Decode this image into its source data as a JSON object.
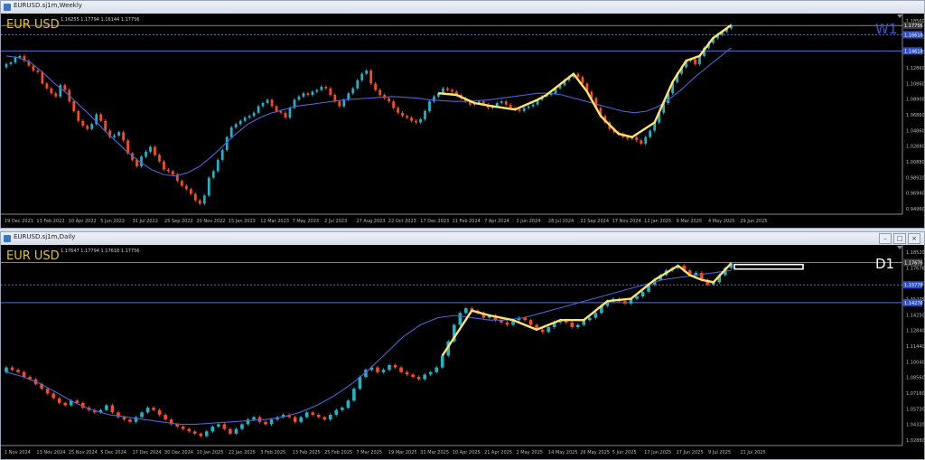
{
  "charts": [
    {
      "window_title": "EURUSD.sj1m,Weekly",
      "symbol_label": "EUR USD",
      "timeframe_label": "W1",
      "ohlc_readout": "1.16255 1.17794 1.16144 1.17756",
      "window_buttons": [],
      "colors": {
        "bull": "#1fb5c9",
        "bear": "#ff4a1a",
        "ma": "#4c63d8",
        "zigzag": "#ffe36e",
        "hline": "#5a6fd8",
        "bg": "#000000",
        "axis": "#b9b9b9"
      },
      "price_labels": [
        "1.18560",
        "1.16650",
        "1.14640",
        "1.12860",
        "1.10860",
        "1.08900",
        "1.06860",
        "1.04860",
        "1.02880",
        "1.00880",
        "0.98920",
        "0.96940",
        "0.94960"
      ],
      "price_tags": [
        {
          "text": "1.17756",
          "value": 1.17756,
          "style": "current"
        },
        {
          "text": "1.16618",
          "value": 1.16618,
          "style": "level"
        },
        {
          "text": "1.14618",
          "value": 1.14618,
          "style": "level"
        }
      ],
      "date_labels": [
        "19 Dec 2021",
        "13 Feb 2022",
        "10 Apr 2022",
        "5 Jun 2022",
        "31 Jul 2022",
        "25 Sep 2022",
        "20 Nov 2022",
        "15 Jan 2023",
        "12 Mar 2023",
        "7 May 2023",
        "2 Jul 2023",
        "27 Aug 2023",
        "22 Oct 2023",
        "17 Dec 2023",
        "11 Feb 2024",
        "7 Apr 2024",
        "2 Jun 2024",
        "28 Jul 2024",
        "22 Sep 2024",
        "17 Nov 2024",
        "12 Jan 2025",
        "9 Mar 2025",
        "4 May 2025",
        "29 Jun 2025"
      ]
    },
    {
      "window_title": "EURUSD.sj1m,Daily",
      "symbol_label": "EUR USD",
      "timeframe_label": "D1",
      "ohlc_readout": "1.17647 1.17794 1.17618 1.17756",
      "window_buttons": [
        "–",
        "□",
        "×"
      ],
      "colors": {
        "bull": "#1fb5c9",
        "bear": "#ff4a1a",
        "ma": "#4c63d8",
        "zigzag": "#ffe36e",
        "hline": "#5a6fd8",
        "bg": "#000000",
        "axis": "#b9b9b9"
      },
      "price_labels": [
        "1.18520",
        "1.17676",
        "1.16240",
        "1.15275",
        "1.14250",
        "1.12840",
        "1.11440",
        "1.10040",
        "1.08560",
        "1.07160",
        "1.05720",
        "1.04320",
        "1.02880"
      ],
      "price_tags": [
        {
          "text": "1.17676",
          "value": 1.17676,
          "style": "current"
        },
        {
          "text": "1.15778",
          "value": 1.15778,
          "style": "level"
        },
        {
          "text": "1.14278",
          "value": 1.14278,
          "style": "level"
        }
      ],
      "date_labels": [
        "1 Nov 2024",
        "13 Nov 2024",
        "25 Nov 2024",
        "5 Dec 2024",
        "17 Dec 2024",
        "30 Dec 2024",
        "10 Jan 2025",
        "22 Jan 2025",
        "3 Feb 2025",
        "13 Feb 2025",
        "25 Feb 2025",
        "7 Mar 2025",
        "19 Mar 2025",
        "31 Mar 2025",
        "10 Apr 2025",
        "21 Apr 2025",
        "2 May 2025",
        "14 May 2025",
        "26 May 2025",
        "5 Jun 2025",
        "17 Jun 2025",
        "27 Jun 2025",
        "9 Jul 2025",
        "21 Jul 2025"
      ]
    }
  ],
  "chart_data": [
    {
      "type": "candlestick",
      "title": "EURUSD.sj1m,Weekly",
      "ylim": [
        0.945,
        1.19
      ],
      "x_range": [
        "19 Dec 2021",
        "29 Jun 2025"
      ],
      "series": [
        {
          "name": "price",
          "values": [
            1.13,
            1.132,
            1.138,
            1.14,
            1.134,
            1.128,
            1.122,
            1.12,
            1.106,
            1.1,
            1.094,
            1.09,
            1.104,
            1.098,
            1.084,
            1.072,
            1.06,
            1.054,
            1.05,
            1.056,
            1.068,
            1.06,
            1.048,
            1.04,
            1.042,
            1.046,
            1.036,
            1.02,
            1.012,
            1.004,
            1.016,
            1.022,
            1.028,
            1.018,
            1.01,
            1.0,
            0.998,
            0.994,
            0.986,
            0.98,
            0.976,
            0.97,
            0.962,
            0.958,
            0.968,
            0.99,
            0.998,
            1.012,
            1.024,
            1.04,
            1.052,
            1.056,
            1.06,
            1.064,
            1.066,
            1.07,
            1.078,
            1.082,
            1.086,
            1.078,
            1.072,
            1.07,
            1.064,
            1.076,
            1.086,
            1.09,
            1.094,
            1.092,
            1.096,
            1.098,
            1.102,
            1.1,
            1.092,
            1.084,
            1.078,
            1.086,
            1.094,
            1.1,
            1.11,
            1.118,
            1.122,
            1.106,
            1.098,
            1.092,
            1.088,
            1.084,
            1.076,
            1.07,
            1.066,
            1.064,
            1.06,
            1.058,
            1.062,
            1.072,
            1.084,
            1.09,
            1.094,
            1.1,
            1.098,
            1.096,
            1.092,
            1.088,
            1.084,
            1.08,
            1.082,
            1.084,
            1.08,
            1.076,
            1.078,
            1.082,
            1.084,
            1.08,
            1.076,
            1.074,
            1.072,
            1.076,
            1.078,
            1.08,
            1.086,
            1.09,
            1.092,
            1.094,
            1.1,
            1.104,
            1.11,
            1.114,
            1.118,
            1.114,
            1.106,
            1.096,
            1.088,
            1.076,
            1.066,
            1.058,
            1.05,
            1.046,
            1.044,
            1.04,
            1.038,
            1.04,
            1.036,
            1.032,
            1.04,
            1.048,
            1.058,
            1.07,
            1.082,
            1.094,
            1.108,
            1.118,
            1.126,
            1.134,
            1.136,
            1.13,
            1.14,
            1.15,
            1.156,
            1.162,
            1.166,
            1.17,
            1.174,
            1.178
          ]
        },
        {
          "name": "ma",
          "values": [
            1.14,
            1.138,
            1.132,
            1.12,
            1.106,
            1.094,
            1.08,
            1.066,
            1.05,
            1.036,
            1.022,
            1.01,
            1.0,
            0.994,
            0.992,
            0.996,
            1.004,
            1.016,
            1.03,
            1.044,
            1.056,
            1.064,
            1.07,
            1.074,
            1.078,
            1.08,
            1.082,
            1.084,
            1.086,
            1.087,
            1.088,
            1.089,
            1.09,
            1.089,
            1.088,
            1.086,
            1.085,
            1.084,
            1.084,
            1.085,
            1.086,
            1.088,
            1.09,
            1.092,
            1.094,
            1.094,
            1.092,
            1.088,
            1.084,
            1.08,
            1.076,
            1.072,
            1.07,
            1.072,
            1.078,
            1.088,
            1.1,
            1.114,
            1.126,
            1.138,
            1.15
          ]
        }
      ]
    },
    {
      "type": "candlestick",
      "title": "EURUSD.sj1m,Daily",
      "ylim": [
        1.022,
        1.19
      ],
      "x_range": [
        "1 Nov 2024",
        "21 Jul 2025"
      ],
      "series": [
        {
          "name": "price",
          "values": [
            1.088,
            1.086,
            1.084,
            1.08,
            1.078,
            1.074,
            1.07,
            1.066,
            1.062,
            1.058,
            1.056,
            1.06,
            1.058,
            1.054,
            1.052,
            1.05,
            1.052,
            1.056,
            1.05,
            1.046,
            1.044,
            1.042,
            1.046,
            1.05,
            1.054,
            1.052,
            1.048,
            1.044,
            1.04,
            1.038,
            1.036,
            1.034,
            1.032,
            1.03,
            1.034,
            1.038,
            1.04,
            1.036,
            1.032,
            1.036,
            1.04,
            1.044,
            1.046,
            1.042,
            1.04,
            1.044,
            1.046,
            1.048,
            1.046,
            1.042,
            1.046,
            1.05,
            1.048,
            1.046,
            1.044,
            1.048,
            1.052,
            1.054,
            1.06,
            1.07,
            1.08,
            1.086,
            1.088,
            1.084,
            1.086,
            1.09,
            1.088,
            1.084,
            1.082,
            1.08,
            1.078,
            1.082,
            1.084,
            1.088,
            1.098,
            1.11,
            1.124,
            1.134,
            1.138,
            1.136,
            1.134,
            1.13,
            1.132,
            1.128,
            1.126,
            1.124,
            1.128,
            1.13,
            1.128,
            1.124,
            1.12,
            1.118,
            1.122,
            1.126,
            1.128,
            1.126,
            1.122,
            1.124,
            1.128,
            1.13,
            1.134,
            1.14,
            1.144,
            1.146,
            1.144,
            1.142,
            1.146,
            1.148,
            1.152,
            1.158,
            1.162,
            1.166,
            1.17,
            1.172,
            1.174,
            1.17,
            1.166,
            1.168,
            1.162,
            1.158,
            1.16,
            1.166,
            1.172,
            1.176
          ]
        },
        {
          "name": "ma",
          "values": [
            1.084,
            1.08,
            1.074,
            1.066,
            1.058,
            1.052,
            1.048,
            1.046,
            1.044,
            1.042,
            1.04,
            1.04,
            1.041,
            1.042,
            1.043,
            1.044,
            1.046,
            1.05,
            1.056,
            1.064,
            1.074,
            1.086,
            1.1,
            1.114,
            1.124,
            1.13,
            1.132,
            1.13,
            1.128,
            1.128,
            1.13,
            1.134,
            1.138,
            1.142,
            1.146,
            1.15,
            1.154,
            1.158,
            1.162,
            1.164,
            1.166,
            1.168,
            1.17
          ]
        }
      ]
    }
  ]
}
